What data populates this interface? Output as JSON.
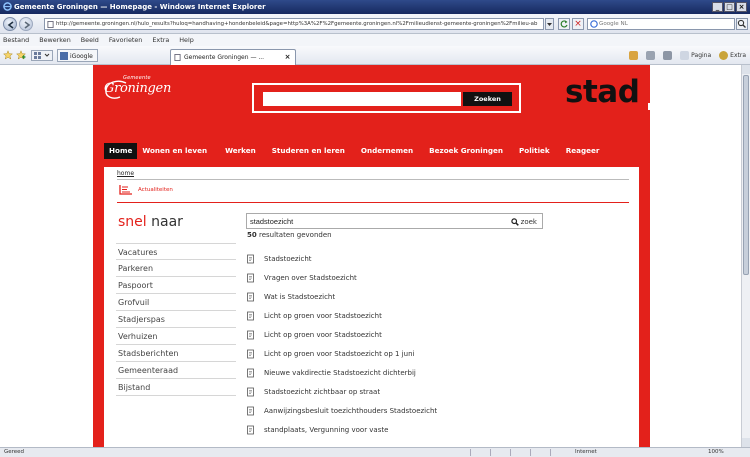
{
  "window": {
    "title": "Gemeente Groningen — Homepage - Windows Internet Explorer",
    "controls": [
      "_",
      "□",
      "×"
    ]
  },
  "address": {
    "url": "http://gemeente.groningen.nl/hulo_results?huloq=handhaving+hondenbeleid&page=http%3A%2F%2Fgemeente.groningen.nl%2Fmilieudienst-gemeente-groningen%2Fmilieu-ab",
    "search_placeholder": "Google NL"
  },
  "menubar": [
    "Bestand",
    "Bewerken",
    "Beeld",
    "Favorieten",
    "Extra",
    "Help"
  ],
  "favorites": {
    "igoogle": "iGoogle",
    "active_tab": "Gemeente Groningen — ...",
    "commands": [
      "Pagina",
      "Extra"
    ]
  },
  "site": {
    "logo_small": "Gemeente",
    "logo_main": "Groningen",
    "search_button": "Zoeken",
    "stad": "stad",
    "nav": [
      "Home",
      "Wonen en leven",
      "Werken",
      "Studeren en leren",
      "Ondernemen",
      "Bezoek Groningen",
      "Politiek",
      "Reageer"
    ],
    "breadcrumb": "home",
    "actueel": "Actualiteiten"
  },
  "quick": {
    "snel": "snel",
    "naar": "naar",
    "items": [
      "Vacatures",
      "Parkeren",
      "Paspoort",
      "Grofvuil",
      "Stadjerspas",
      "Verhuizen",
      "Stadsberichten",
      "Gemeenteraad",
      "Bijstand"
    ]
  },
  "results": {
    "query": "stadstoezicht",
    "button": "zoek",
    "count": "50",
    "count_text": "resultaten gevonden",
    "items": [
      "Stadstoezicht",
      "Vragen over Stadstoezicht",
      "Wat is Stadstoezicht",
      "Licht op groen voor Stadstoezicht",
      "Licht op groen voor Stadstoezicht",
      "Licht op groen voor Stadstoezicht op 1 juni",
      "Nieuwe vakdirectie Stadstoezicht dichterbij",
      "Stadstoezicht zichtbaar op straat",
      "Aanwijzingsbesluit toezichthouders Stadstoezicht",
      "standplaats, Vergunning voor vaste"
    ]
  },
  "status": {
    "left": "Gereed",
    "zone": "Internet",
    "zoom": "100%"
  },
  "colors": {
    "brand_red": "#e3211b",
    "nav_active": "#111111"
  }
}
